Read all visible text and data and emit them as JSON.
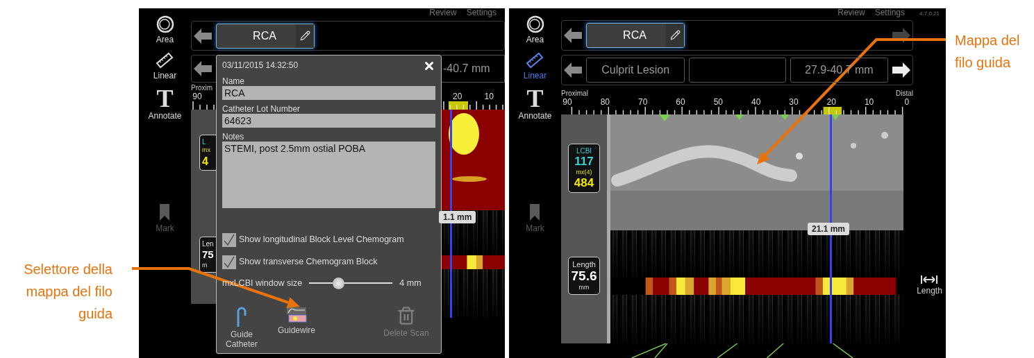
{
  "left_caption": "Selettore della mappa del filo guida",
  "right_caption": "Mappa del filo guida",
  "left_screen": {
    "menu": [
      "Review",
      "Settings"
    ],
    "tools": [
      {
        "kind": "area",
        "label": "Area",
        "selected": false,
        "disabled": false
      },
      {
        "kind": "linear",
        "label": "Linear",
        "selected": false,
        "disabled": false
      },
      {
        "kind": "annotate",
        "label": "Annotate",
        "glyph": "T",
        "selected": false,
        "disabled": false
      },
      {
        "kind": "mark",
        "label": "Mark",
        "selected": false,
        "disabled": true
      }
    ],
    "vessel": "RCA",
    "segment_range": "-40.7 mm",
    "scale_start": "Proxim",
    "scale_left_ticks": [
      "90"
    ],
    "scale_right_ticks": [
      "20",
      "10"
    ],
    "lcbi": {
      "label": "L",
      "mx_label": "mx",
      "value": "4"
    },
    "length": {
      "label": "Len",
      "value": "75",
      "unit": "m"
    },
    "position": "1.1 mm",
    "dialog": {
      "timestamp": "03/11/2015 14:32:50",
      "fields": [
        {
          "label": "Name",
          "value": "RCA"
        },
        {
          "label": "Catheter Lot Number",
          "value": "64623"
        }
      ],
      "notes": {
        "label": "Notes",
        "value": "STEMI, post 2.5mm ostial POBA"
      },
      "options": [
        {
          "label": "Show longitudinal Block Level Chemogram",
          "checked": true
        },
        {
          "label": "Show transverse Chemogram Block",
          "checked": true
        }
      ],
      "window_size": {
        "label": "mxLCBI window size",
        "level": 0.35,
        "reading": "4 mm"
      },
      "actions": [
        {
          "kind": "guide-catheter",
          "label": "Guide Catheter",
          "disabled": false
        },
        {
          "kind": "guidewire",
          "label": "Guidewire",
          "disabled": false
        },
        {
          "kind": "delete",
          "label": "Delete Scan",
          "disabled": true
        }
      ]
    }
  },
  "right_screen": {
    "menu": [
      "Review",
      "Settings"
    ],
    "version": "4.7.0.21",
    "tools": [
      {
        "kind": "area",
        "label": "Area",
        "selected": false,
        "disabled": false
      },
      {
        "kind": "linear",
        "label": "Linear",
        "selected": true,
        "disabled": false
      },
      {
        "kind": "annotate",
        "label": "Annotate",
        "glyph": "T",
        "selected": false,
        "disabled": false
      },
      {
        "kind": "mark",
        "label": "Mark",
        "selected": false,
        "disabled": true
      }
    ],
    "side_tools": [
      {
        "kind": "length",
        "label": "Length"
      }
    ],
    "vessel": "RCA",
    "segment": {
      "name": "Culprit Lesion",
      "range": "27.9-40.7 mm"
    },
    "scale": {
      "start": "Proximal",
      "end": "Distal",
      "ticks": [
        "90",
        "80",
        "70",
        "60",
        "50",
        "40",
        "30",
        "20",
        "10",
        "0"
      ]
    },
    "lcbi": {
      "label": "LCBI",
      "value": "117",
      "mx_label": "mx(4)",
      "mx_value": "484"
    },
    "length": {
      "label": "Length",
      "value": "75.6",
      "unit": "mm"
    },
    "position": "21.1 mm"
  }
}
